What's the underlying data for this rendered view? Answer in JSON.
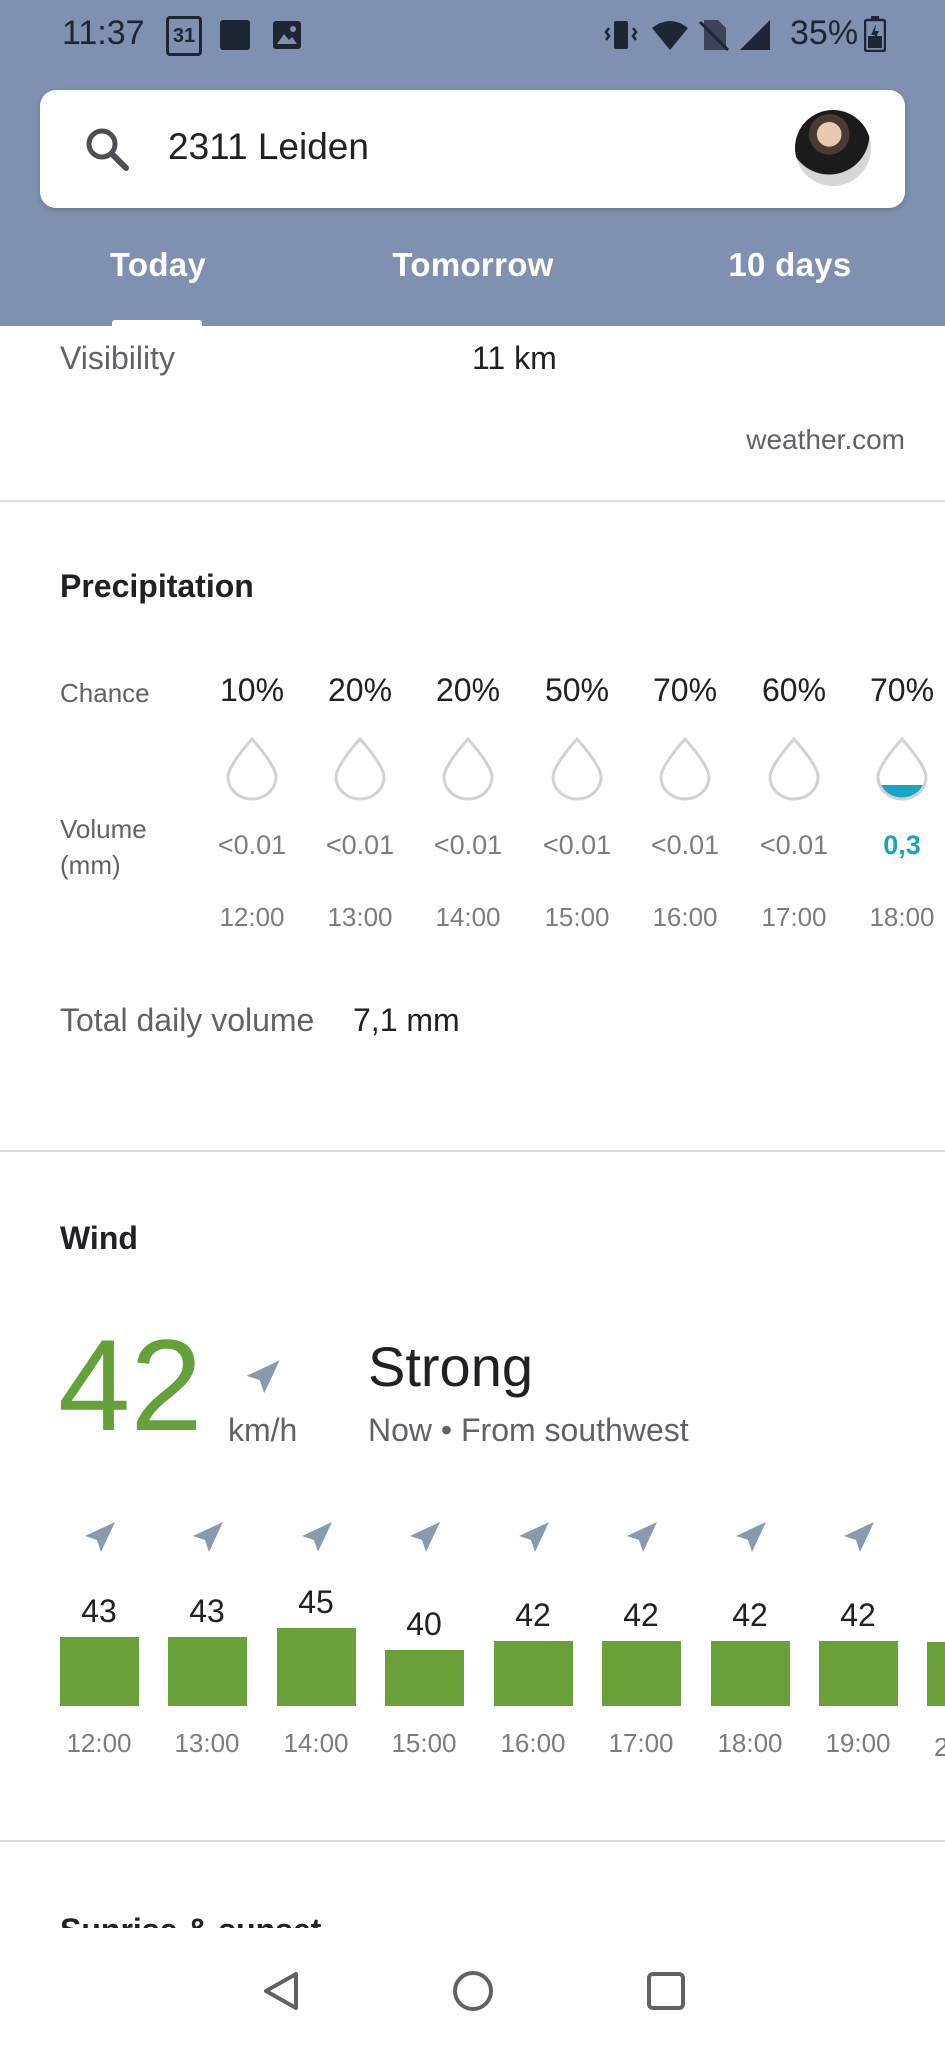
{
  "status_bar": {
    "time": "11:37",
    "calendar_badge": "31",
    "battery": "35%"
  },
  "search": {
    "query": "2311 Leiden"
  },
  "tabs": [
    {
      "label": "Today"
    },
    {
      "label": "Tomorrow"
    },
    {
      "label": "10 days"
    }
  ],
  "visibility": {
    "label": "Visibility",
    "value": "11 km",
    "source": "weather.com"
  },
  "precipitation": {
    "title": "Precipitation",
    "chance_label": "Chance",
    "volume_label_1": "Volume",
    "volume_label_2": "(mm)",
    "hours": [
      {
        "chance": "10%",
        "volume": "<0.01",
        "time": "12:00",
        "fill": 0
      },
      {
        "chance": "20%",
        "volume": "<0.01",
        "time": "13:00",
        "fill": 0
      },
      {
        "chance": "20%",
        "volume": "<0.01",
        "time": "14:00",
        "fill": 0
      },
      {
        "chance": "50%",
        "volume": "<0.01",
        "time": "15:00",
        "fill": 0
      },
      {
        "chance": "70%",
        "volume": "<0.01",
        "time": "16:00",
        "fill": 0
      },
      {
        "chance": "60%",
        "volume": "<0.01",
        "time": "17:00",
        "fill": 0
      },
      {
        "chance": "70%",
        "volume": "0,3",
        "time": "18:00",
        "fill": 0.3
      }
    ],
    "total_label": "Total daily volume",
    "total_value": "7,1 mm"
  },
  "wind": {
    "title": "Wind",
    "speed": "42",
    "unit": "km/h",
    "description": "Strong",
    "subtitle": "Now • From southwest",
    "hours": [
      {
        "speed": 43,
        "time": "12:00"
      },
      {
        "speed": 43,
        "time": "13:00"
      },
      {
        "speed": 45,
        "time": "14:00"
      },
      {
        "speed": 40,
        "time": "15:00"
      },
      {
        "speed": 42,
        "time": "16:00"
      },
      {
        "speed": 42,
        "time": "17:00"
      },
      {
        "speed": 42,
        "time": "18:00"
      },
      {
        "speed": 42,
        "time": "19:00"
      }
    ]
  },
  "sunrise": {
    "title": "Sunrise & sunset"
  },
  "colors": {
    "header_bg": "#7f91b0",
    "wind_green": "#6aa03a",
    "rain_blue": "#1aa3c2"
  }
}
